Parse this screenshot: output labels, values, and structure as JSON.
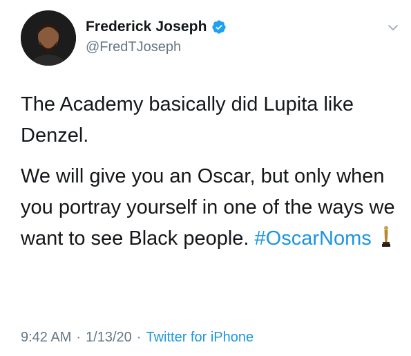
{
  "author": {
    "display_name": "Frederick Joseph",
    "handle": "@FredTJoseph",
    "verified": true
  },
  "tweet": {
    "paragraph_1": "The Academy basically did Lupita like Denzel.",
    "paragraph_2": "We will give you an Oscar, but only when you portray yourself in one of the ways we want to see Black people.",
    "hashtag": "#OscarNoms"
  },
  "meta": {
    "time": "9:42 AM",
    "separator": "·",
    "date": "1/13/20",
    "source": "Twitter for iPhone"
  },
  "colors": {
    "link": "#1b95e0",
    "secondary_text": "#657786",
    "verified_badge": "#1da1f2"
  },
  "icons": [
    "verified-badge-icon",
    "chevron-down-icon",
    "oscar-trophy-icon"
  ]
}
